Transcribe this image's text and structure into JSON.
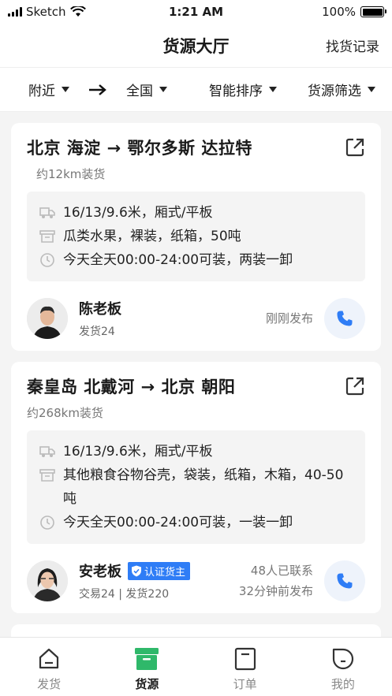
{
  "status_bar": {
    "carrier": "Sketch",
    "time": "1:21 AM",
    "battery": "100%"
  },
  "header": {
    "title": "货源大厅",
    "right_link": "找货记录"
  },
  "filters": {
    "origin": "附近",
    "destination": "全国",
    "sort": "智能排序",
    "screen": "货源筛选"
  },
  "cards": [
    {
      "route": "北京 海淀 → 鄂尔多斯 达拉特",
      "distance": "约12km装货",
      "spec": "16/13/9.6米，厢式/平板",
      "cargo": "瓜类水果，裸装，纸箱，50吨",
      "time": "今天全天00:00-24:00可装，两装一卸",
      "owner_name": "陈老板",
      "owner_sub": "发货24",
      "published": "刚刚发布"
    },
    {
      "route": "秦皇岛 北戴河 → 北京 朝阳",
      "distance": "约268km装货",
      "spec": "16/13/9.6米，厢式/平板",
      "cargo": "其他粮食谷物谷壳，袋装，纸箱，木箱，40-50吨",
      "time": "今天全天00:00-24:00可装，一装一卸",
      "owner_name": "安老板",
      "badge": "认证货主",
      "owner_sub": "交易24 | 发货220",
      "contacts": "48人已联系",
      "published": "32分钟前发布"
    }
  ],
  "tabs": [
    {
      "label": "发货",
      "icon": "home-icon"
    },
    {
      "label": "货源",
      "icon": "cargo-box-icon"
    },
    {
      "label": "订单",
      "icon": "order-icon"
    },
    {
      "label": "我的",
      "icon": "profile-icon"
    }
  ],
  "colors": {
    "accent": "#2f7df6",
    "tab_active": "#2fb86a"
  }
}
